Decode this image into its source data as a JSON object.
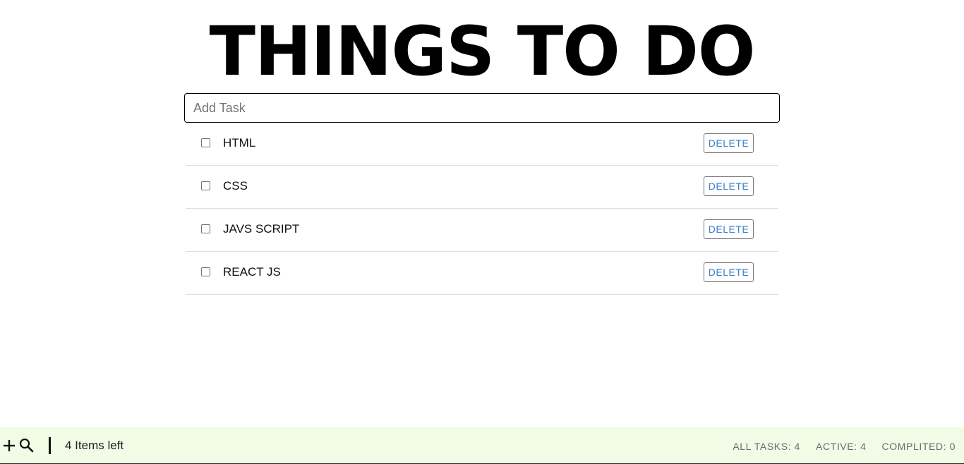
{
  "title": "THINGS TO DO",
  "input": {
    "placeholder": "Add Task",
    "value": ""
  },
  "tasks": [
    {
      "label": "HTML",
      "completed": false,
      "delete_label": "DELETE"
    },
    {
      "label": "CSS",
      "completed": false,
      "delete_label": "DELETE"
    },
    {
      "label": "JAVS SCRIPT",
      "completed": false,
      "delete_label": "DELETE"
    },
    {
      "label": "REACT JS",
      "completed": false,
      "delete_label": "DELETE"
    }
  ],
  "footer": {
    "icons": [
      "plus-icon",
      "search-icon"
    ],
    "items_left": "4 Items left",
    "filters": {
      "all": "ALL TASKS: 4",
      "active": "ACTIVE: 4",
      "completed": "COMPLITED: 0"
    }
  },
  "colors": {
    "footer_bg": "#f1fbe6",
    "delete_text": "#3b7fc4",
    "filter_text": "#6b6b6b"
  }
}
